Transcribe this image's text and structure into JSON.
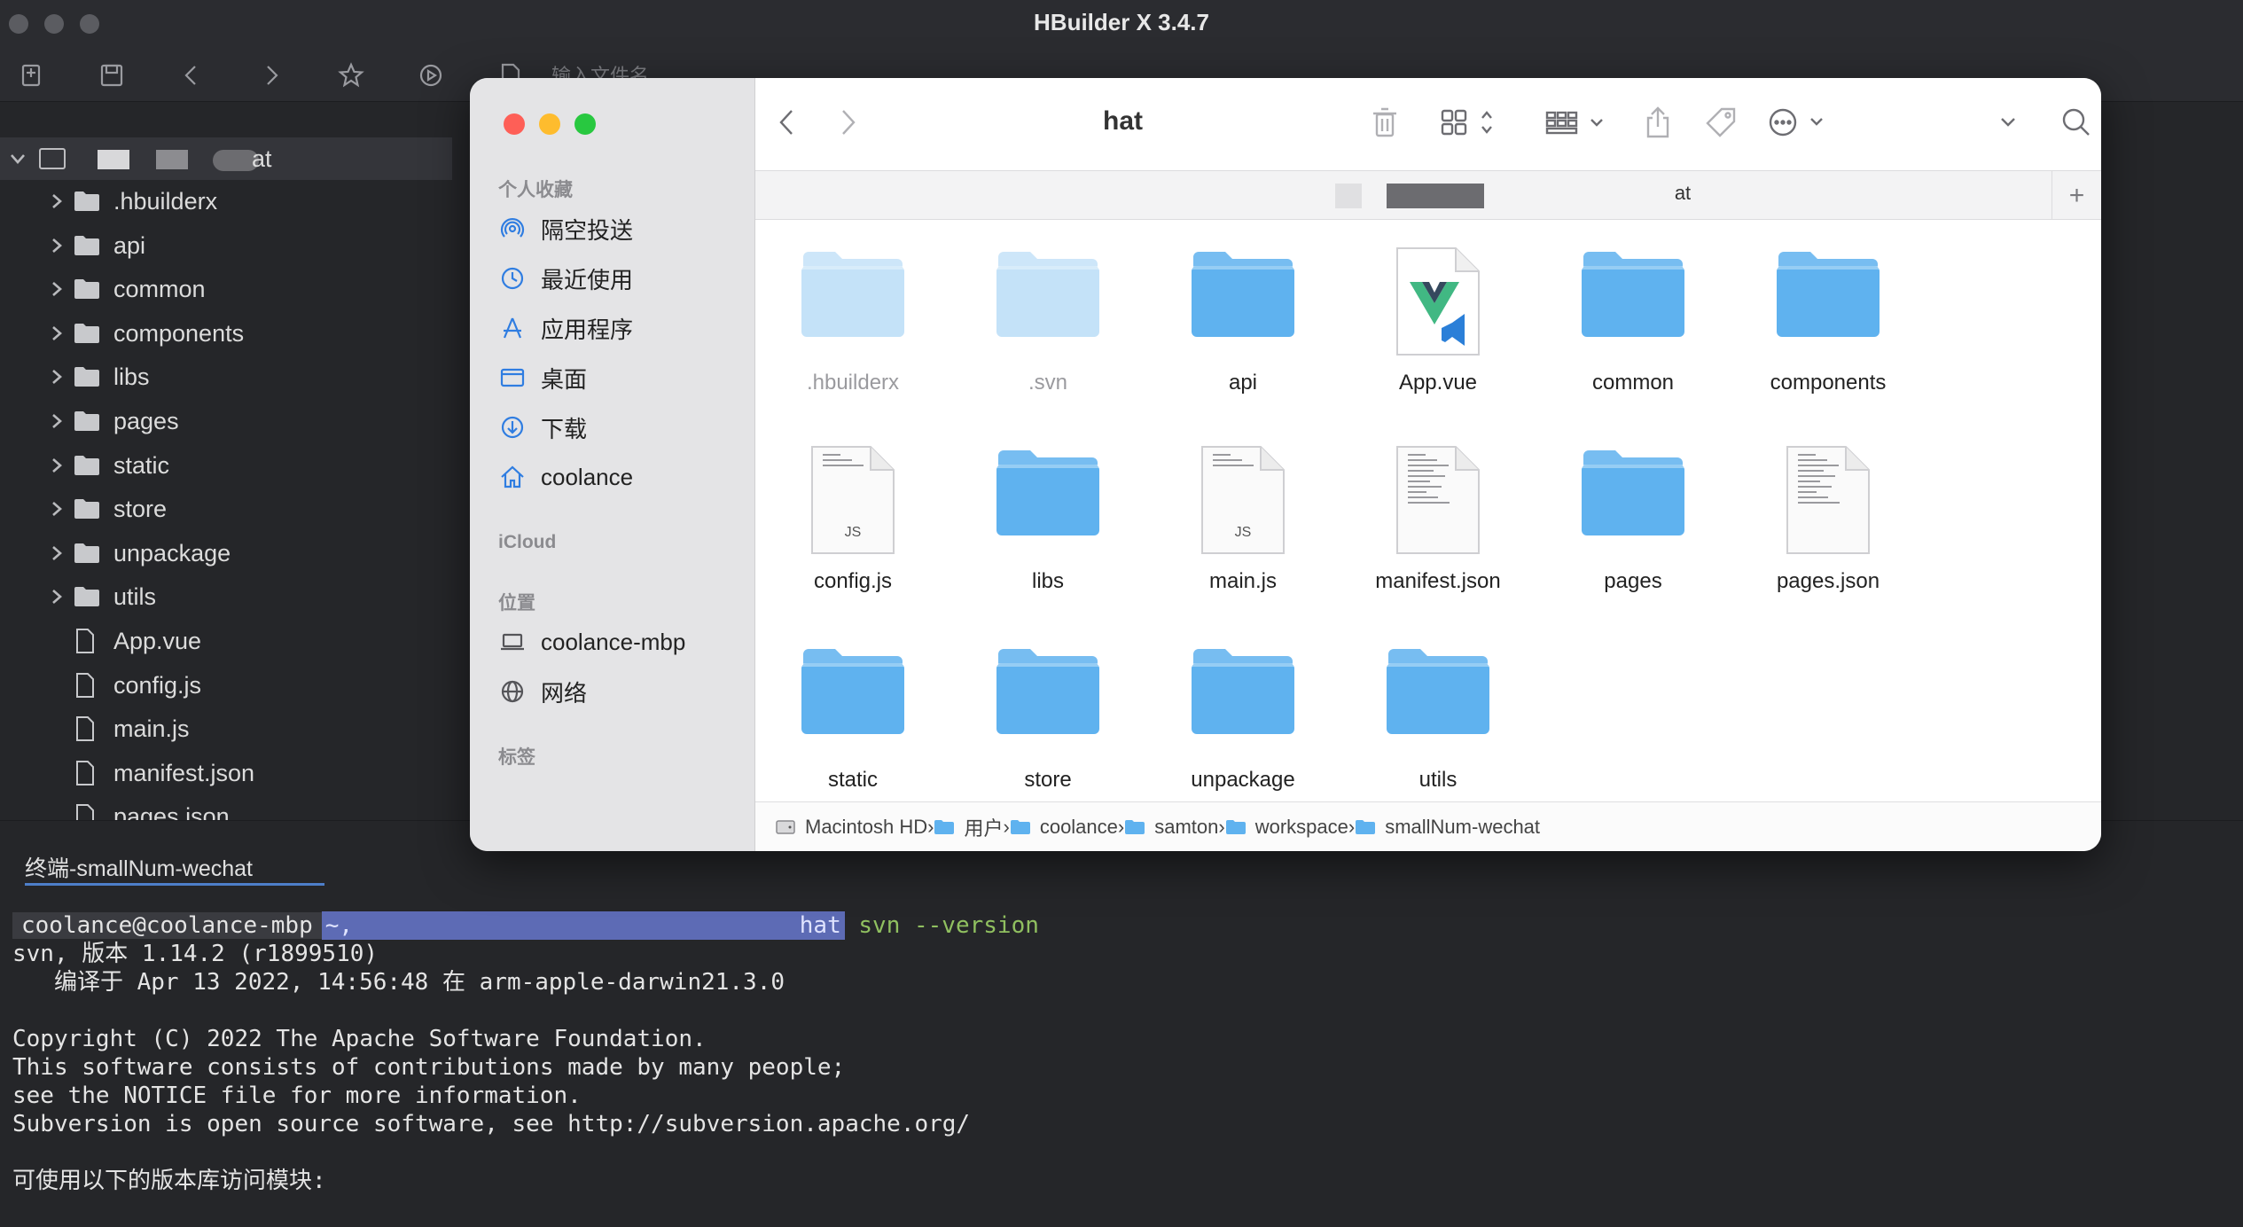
{
  "app": {
    "title": "HBuilder X 3.4.7"
  },
  "toolbar": {
    "file_input_placeholder": "输入文件名",
    "buttons": [
      "new-file-icon",
      "save-icon",
      "back-icon",
      "forward-icon",
      "star-icon",
      "run-icon",
      "file-search-icon"
    ]
  },
  "project_tree": {
    "root_label": "at",
    "items": [
      {
        "type": "folder",
        "label": ".hbuilderx"
      },
      {
        "type": "folder",
        "label": "api"
      },
      {
        "type": "folder",
        "label": "common"
      },
      {
        "type": "folder",
        "label": "components"
      },
      {
        "type": "folder",
        "label": "libs"
      },
      {
        "type": "folder",
        "label": "pages"
      },
      {
        "type": "folder",
        "label": "static"
      },
      {
        "type": "folder",
        "label": "store"
      },
      {
        "type": "folder",
        "label": "unpackage"
      },
      {
        "type": "folder",
        "label": "utils"
      },
      {
        "type": "file",
        "label": "App.vue"
      },
      {
        "type": "file",
        "label": "config.js"
      },
      {
        "type": "file",
        "label": "main.js"
      },
      {
        "type": "file",
        "label": "manifest.json"
      },
      {
        "type": "file",
        "label": "pages.json"
      }
    ]
  },
  "terminal": {
    "tab_label": "终端-smallNum-wechat",
    "prompt_user": "coolance@coolance-mbp",
    "prompt_path_start": "~,",
    "prompt_path_end": "hat",
    "command": "svn --version",
    "output": [
      "svn, 版本 1.14.2 (r1899510)",
      "   编译于 Apr 13 2022, 14:56:48 在 arm-apple-darwin21.3.0",
      "",
      "Copyright (C) 2022 The Apache Software Foundation.",
      "This software consists of contributions made by many people;",
      "see the NOTICE file for more information.",
      "Subversion is open source software, see http://subversion.apache.org/",
      "",
      "可使用以下的版本库访问模块:"
    ]
  },
  "finder": {
    "title": "hat",
    "path_tab_label": "at",
    "sidebar": {
      "favorites_header": "个人收藏",
      "favorites": [
        {
          "label": "隔空投送",
          "icon": "airdrop-icon"
        },
        {
          "label": "最近使用",
          "icon": "clock-icon"
        },
        {
          "label": "应用程序",
          "icon": "applications-icon"
        },
        {
          "label": "桌面",
          "icon": "desktop-icon"
        },
        {
          "label": "下载",
          "icon": "download-icon"
        },
        {
          "label": "coolance",
          "icon": "home-icon"
        }
      ],
      "icloud_header": "iCloud",
      "locations_header": "位置",
      "locations": [
        {
          "label": "coolance-mbp",
          "icon": "laptop-icon"
        },
        {
          "label": "网络",
          "icon": "network-icon"
        }
      ],
      "tags_header": "标签"
    },
    "items": [
      {
        "label": ".hbuilderx",
        "kind": "folder-dim"
      },
      {
        "label": ".svn",
        "kind": "folder-dim"
      },
      {
        "label": "api",
        "kind": "folder"
      },
      {
        "label": "App.vue",
        "kind": "vue"
      },
      {
        "label": "common",
        "kind": "folder"
      },
      {
        "label": "components",
        "kind": "folder"
      },
      {
        "label": "config.js",
        "kind": "js",
        "badge": "JS"
      },
      {
        "label": "libs",
        "kind": "folder"
      },
      {
        "label": "main.js",
        "kind": "js",
        "badge": "JS"
      },
      {
        "label": "manifest.json",
        "kind": "doc"
      },
      {
        "label": "pages",
        "kind": "folder"
      },
      {
        "label": "pages.json",
        "kind": "doc"
      },
      {
        "label": "static",
        "kind": "folder"
      },
      {
        "label": "store",
        "kind": "folder"
      },
      {
        "label": "unpackage",
        "kind": "folder"
      },
      {
        "label": "utils",
        "kind": "folder"
      }
    ],
    "path_bar": [
      "Macintosh HD",
      "用户",
      "coolance",
      "samton",
      "workspace",
      "smallNum-wechat"
    ],
    "colors": {
      "folder": "#5fb2ef",
      "folder_dim": "#c4e2f8",
      "accent": "#2f7de1"
    }
  }
}
